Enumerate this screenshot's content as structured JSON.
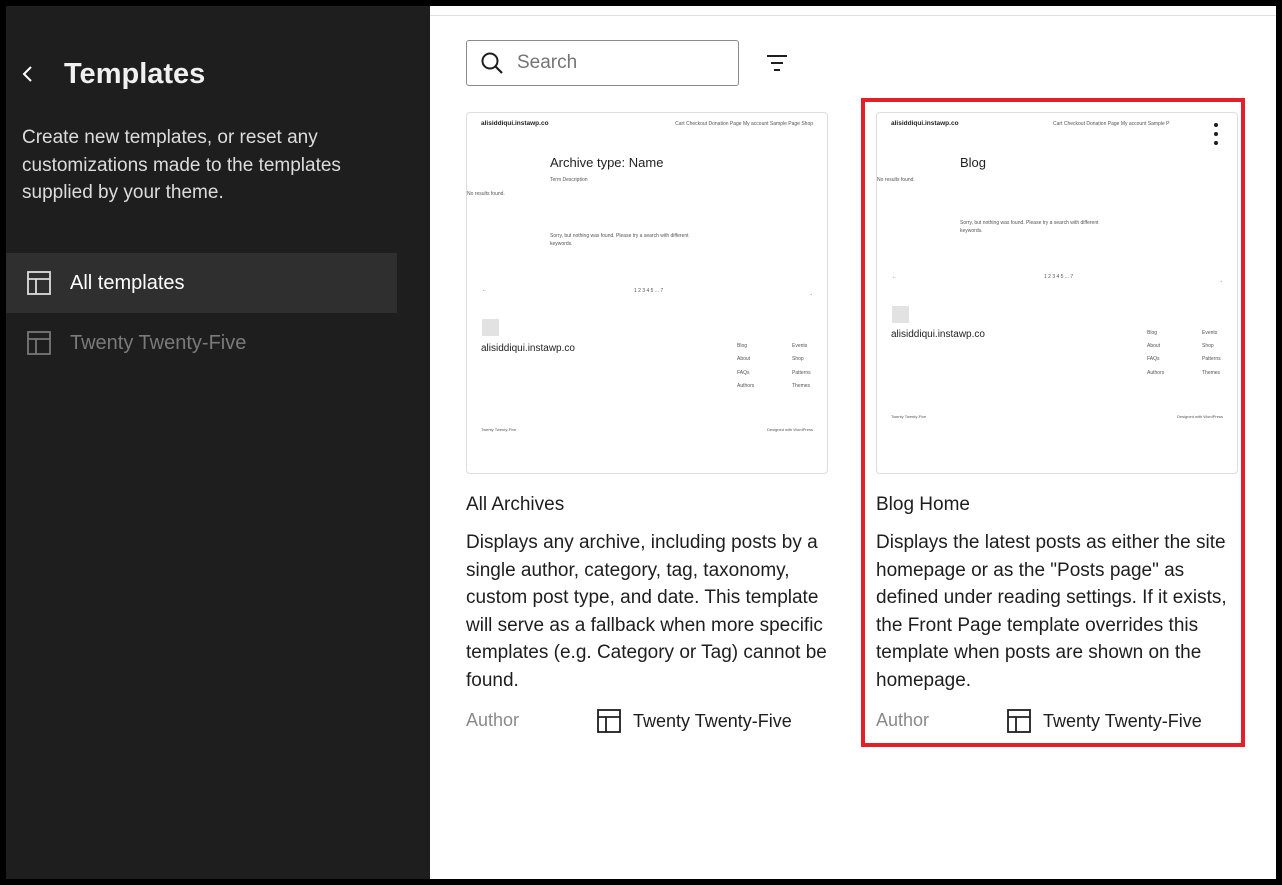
{
  "sidebar": {
    "title": "Templates",
    "description": "Create new templates, or reset any customizations made to the templates supplied by your theme.",
    "nav": [
      {
        "label": "All templates",
        "icon": "layout-icon",
        "active": true
      },
      {
        "label": "Twenty Twenty-Five",
        "icon": "layout-icon",
        "active": false
      }
    ]
  },
  "toolbar": {
    "search_placeholder": "Search",
    "filter_icon": "filter-icon"
  },
  "cards": [
    {
      "title": "All Archives",
      "description": "Displays any archive, including posts by a single author, category, tag, taxonomy, custom post type, and date. This template will serve as a fallback when more specific templates (e.g. Category or Tag) cannot be found.",
      "author_label": "Author",
      "author": "Twenty Twenty-Five",
      "preview": {
        "site": "alisiddiqui.instawp.co",
        "nav": "Cart   Checkout   Donation Page   My account   Sample Page   Shop",
        "heading": "Archive type: Name",
        "sub": "Term Description",
        "no_results": "No results found.",
        "sorry1": "Sorry, but nothing was found. Please try a search with different",
        "sorry2": "keywords.",
        "prev": "←",
        "pages": "1 2 3 4 5 ... 7",
        "next": "→",
        "footer_site": "alisiddiqui.instawp.co",
        "col1": [
          "Blog",
          "About",
          "FAQs",
          "Authors"
        ],
        "col2": [
          "Events",
          "Shop",
          "Patterns",
          "Themes"
        ],
        "bottom_left": "Twenty Twenty-Five",
        "bottom_right": "Designed with WordPress"
      }
    },
    {
      "title": "Blog Home",
      "description": "Displays the latest posts as either the site homepage or as the \"Posts page\" as defined under reading settings. If it exists, the Front Page template overrides this template when posts are shown on the homepage.",
      "author_label": "Author",
      "author": "Twenty Twenty-Five",
      "preview": {
        "site": "alisiddiqui.instawp.co",
        "nav": "Cart   Checkout   Donation Page   My account   Sample P",
        "heading": "Blog",
        "no_results": "No results found.",
        "sorry1": "Sorry, but nothing was found. Please try a search with different",
        "sorry2": "keywords.",
        "prev": "←",
        "pages": "1 2 3 4 5 ... 7",
        "next": "→",
        "footer_site": "alisiddiqui.instawp.co",
        "col1": [
          "Blog",
          "About",
          "FAQs",
          "Authors"
        ],
        "col2": [
          "Events",
          "Shop",
          "Patterns",
          "Themes"
        ],
        "bottom_left": "Twenty Twenty-Five",
        "bottom_right": "Designed with WordPress"
      }
    }
  ],
  "colors": {
    "sidebar_bg": "#1e1e1e",
    "active_item_bg": "#2f2f2f",
    "highlight": "#e3202a"
  }
}
